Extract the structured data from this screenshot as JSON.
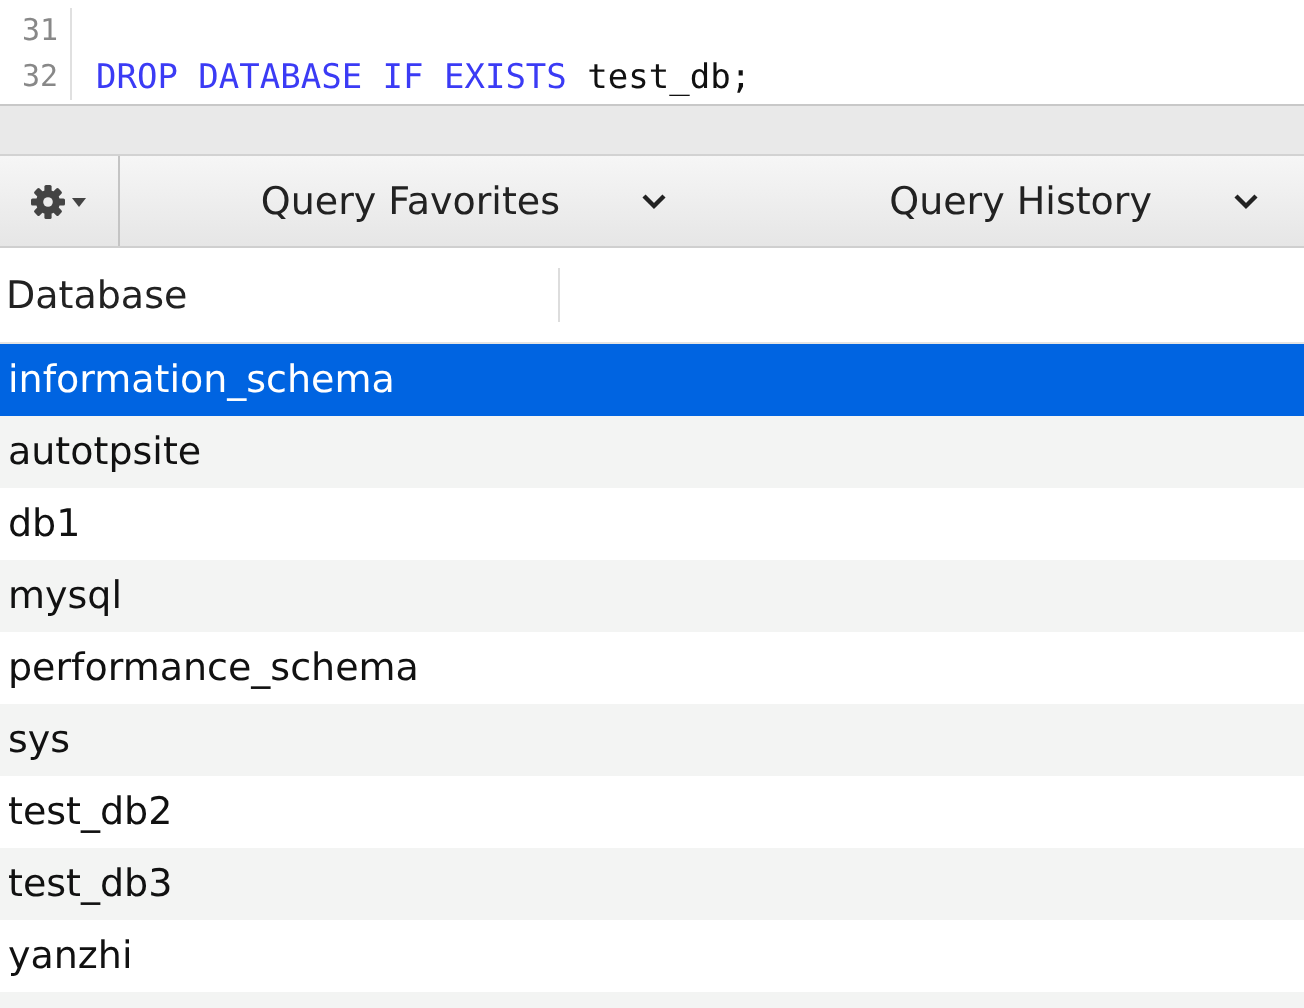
{
  "editor": {
    "lines": [
      {
        "number": "31"
      },
      {
        "number": "32",
        "tokens": [
          {
            "text": "DROP DATABASE IF EXISTS",
            "kind": "keyword"
          },
          {
            "text": "test_db;",
            "kind": "plain"
          }
        ]
      }
    ]
  },
  "toolbar": {
    "tabs": [
      {
        "label": "Query Favorites"
      },
      {
        "label": "Query History"
      }
    ]
  },
  "table": {
    "columns": [
      "Database"
    ],
    "rows": [
      {
        "name": "information_schema",
        "selected": true
      },
      {
        "name": "autotpsite",
        "selected": false
      },
      {
        "name": "db1",
        "selected": false
      },
      {
        "name": "mysql",
        "selected": false
      },
      {
        "name": "performance_schema",
        "selected": false
      },
      {
        "name": "sys",
        "selected": false
      },
      {
        "name": "test_db2",
        "selected": false
      },
      {
        "name": "test_db3",
        "selected": false
      },
      {
        "name": "yanzhi",
        "selected": false
      }
    ]
  }
}
